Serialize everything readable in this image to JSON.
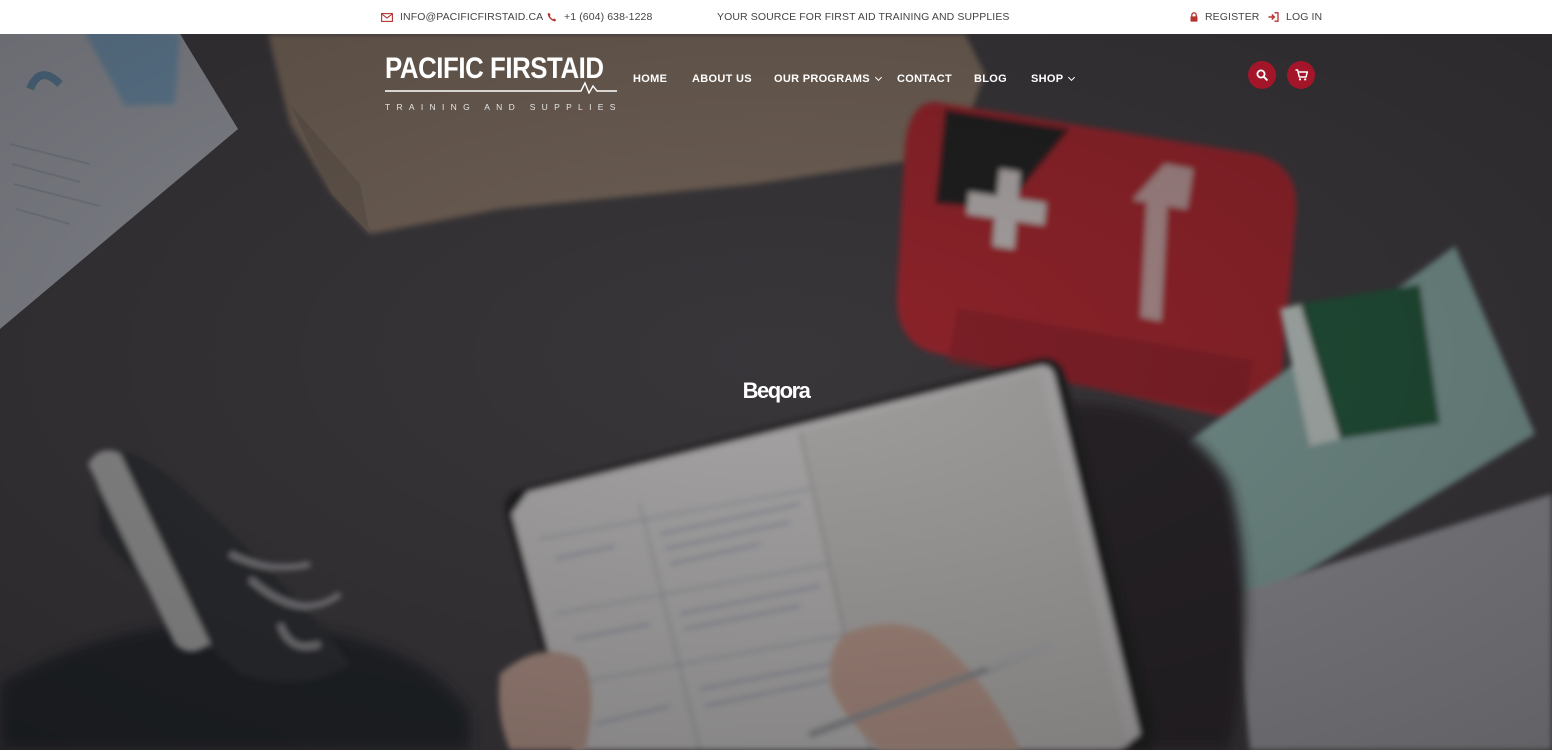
{
  "topbar": {
    "email": "INFO@PACIFICFIRSTAID.CA",
    "phone": "+1 (604) 638-1228",
    "tagline": "YOUR SOURCE FOR FIRST AID TRAINING AND SUPPLIES",
    "register": "REGISTER",
    "login": "LOG IN"
  },
  "brand": {
    "name": "PACIFIC FIRSTAID",
    "tagline": "TRAINING AND SUPPLIES"
  },
  "nav": {
    "items": [
      {
        "label": "HOME"
      },
      {
        "label": "ABOUT US"
      },
      {
        "label": "OUR PROGRAMS",
        "dropdown": true
      },
      {
        "label": "CONTACT"
      },
      {
        "label": "BLOG"
      },
      {
        "label": "SHOP",
        "dropdown": true
      }
    ]
  },
  "icons": {
    "email": "envelope-icon",
    "phone": "phone-icon",
    "register": "lock-icon",
    "login": "sign-in-icon",
    "search": "search-icon",
    "cart": "cart-icon"
  },
  "hero": {
    "title": "Beqora"
  },
  "colors": {
    "accent": "#a3162a",
    "icon_red": "#b5322f",
    "topbar_text": "#444444"
  }
}
